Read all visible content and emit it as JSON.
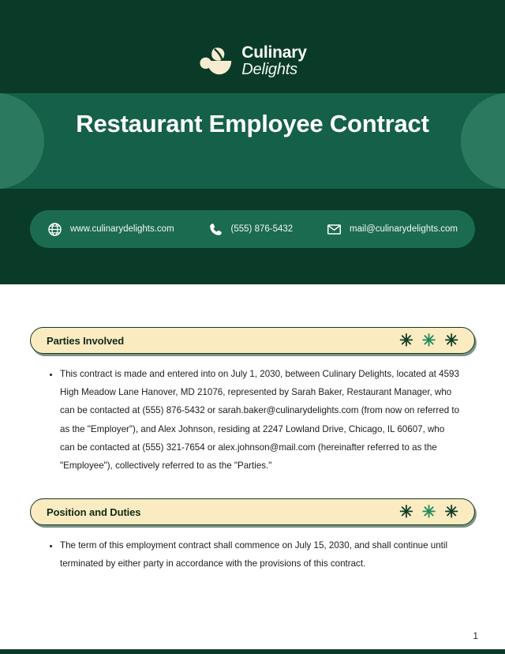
{
  "brand": {
    "logo_icon": "mortar-and-pestle-icon",
    "name_line1": "Culinary",
    "name_line2": "Delights",
    "logo_color": "#f7ecd0",
    "header_bg": "#0a3b28",
    "banner_bg": "#156048",
    "banner_blob": "#2b7a5f"
  },
  "header": {
    "title": "Restaurant Employee Contract"
  },
  "contact": {
    "website": {
      "icon": "globe-icon",
      "text": "www.culinarydelights.com"
    },
    "phone": {
      "icon": "phone-icon",
      "text": "(555) 876-5432"
    },
    "email": {
      "icon": "envelope-icon",
      "text": "mail@culinarydelights.com"
    },
    "pill_color": "#1b6b50"
  },
  "sections": [
    {
      "title": "Parties Involved",
      "accent_bg": "#fbebc0",
      "accent_border": "#123a22",
      "decor": [
        "✳",
        "✳",
        "✳"
      ],
      "decor_colors": [
        "#0f3d2a",
        "#21885f",
        "#0f3d2a"
      ],
      "items": [
        "This contract is made and entered into on July 1, 2030, between Culinary Delights, located at 4593 High Meadow Lane Hanover, MD 21076, represented by Sarah Baker, Restaurant Manager, who can be contacted at (555) 876-5432 or sarah.baker@culinarydelights.com (from now on referred to as the \"Employer\"), and Alex Johnson, residing at 2247 Lowland Drive, Chicago, IL 60607, who can be contacted at (555) 321-7654 or alex.johnson@mail.com (hereinafter referred to as the \"Employee\"), collectively referred to as the \"Parties.\""
      ]
    },
    {
      "title": "Position and Duties",
      "accent_bg": "#fbebc0",
      "accent_border": "#123a22",
      "decor": [
        "✳",
        "✳",
        "✳"
      ],
      "decor_colors": [
        "#0f3d2a",
        "#21885f",
        "#0f3d2a"
      ],
      "items": [
        "The term of this employment contract shall commence on July 15, 2030, and shall continue until terminated by either party in accordance with the provisions of this contract."
      ]
    }
  ],
  "footer": {
    "page_number": "1",
    "bar_color": "#0a3b28"
  }
}
